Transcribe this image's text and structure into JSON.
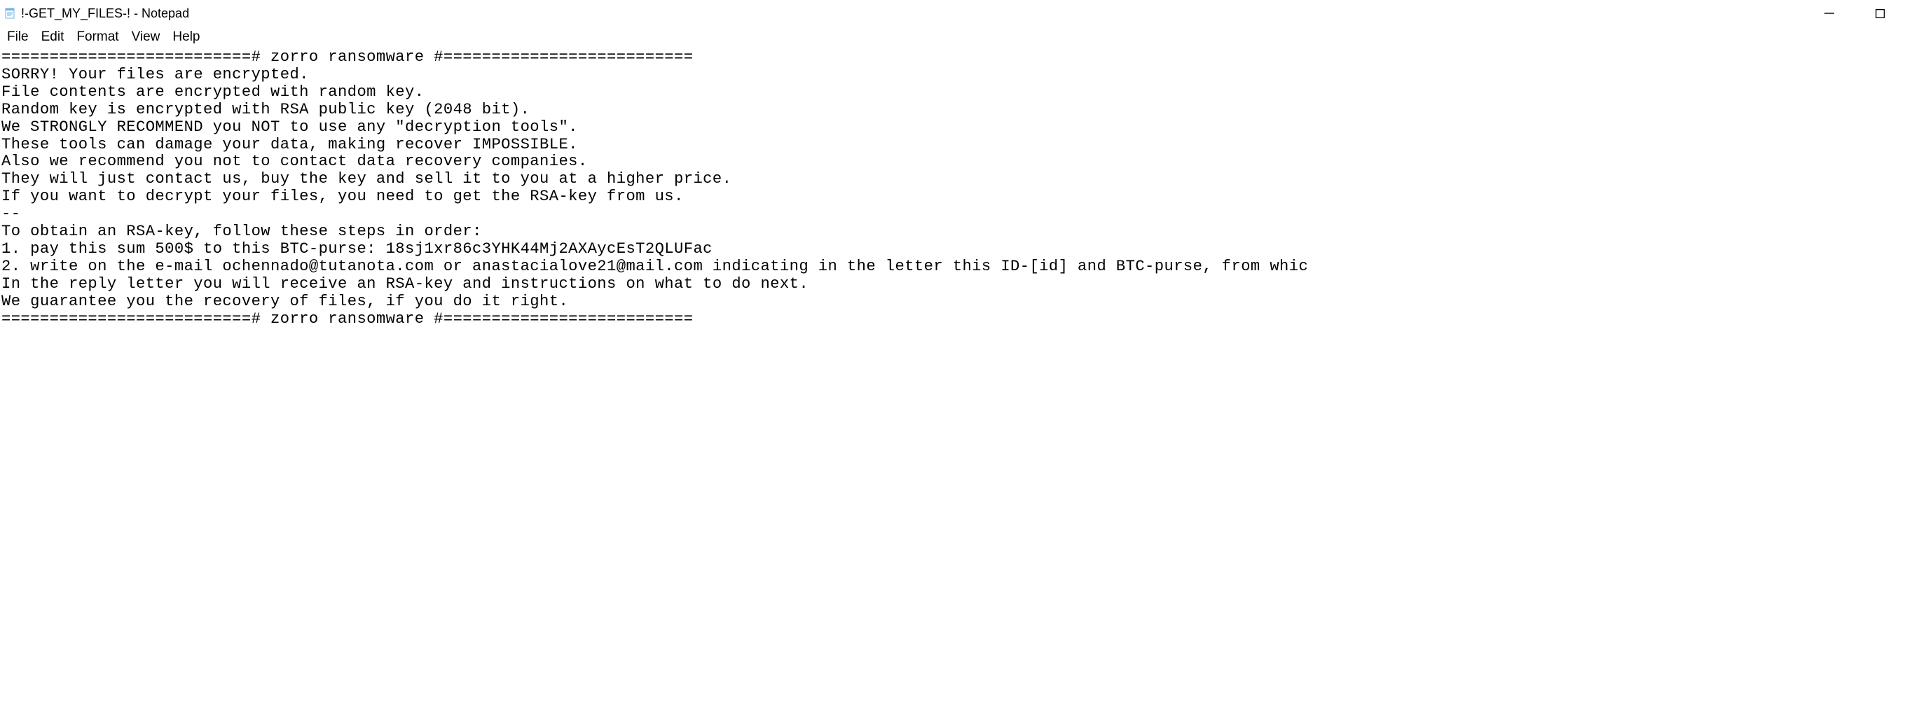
{
  "window": {
    "title": "!-GET_MY_FILES-! - Notepad"
  },
  "menubar": {
    "file": "File",
    "edit": "Edit",
    "format": "Format",
    "view": "View",
    "help": "Help"
  },
  "document": {
    "lines": [
      "==========================# zorro ransomware #==========================",
      "SORRY! Your files are encrypted.",
      "File contents are encrypted with random key.",
      "Random key is encrypted with RSA public key (2048 bit).",
      "We STRONGLY RECOMMEND you NOT to use any \"decryption tools\".",
      "These tools can damage your data, making recover IMPOSSIBLE.",
      "Also we recommend you not to contact data recovery companies.",
      "They will just contact us, buy the key and sell it to you at a higher price.",
      "If you want to decrypt your files, you need to get the RSA-key from us.",
      "--",
      "To obtain an RSA-key, follow these steps in order:",
      "1. pay this sum 500$ to this BTC-purse: 18sj1xr86c3YHK44Mj2AXAycEsT2QLUFac",
      "2. write on the e-mail ochennado@tutanota.com or anastacialove21@mail.com indicating in the letter this ID-[id] and BTC-purse, from whic",
      "In the reply letter you will receive an RSA-key and instructions on what to do next.",
      "We guarantee you the recovery of files, if you do it right.",
      "==========================# zorro ransomware #=========================="
    ]
  }
}
